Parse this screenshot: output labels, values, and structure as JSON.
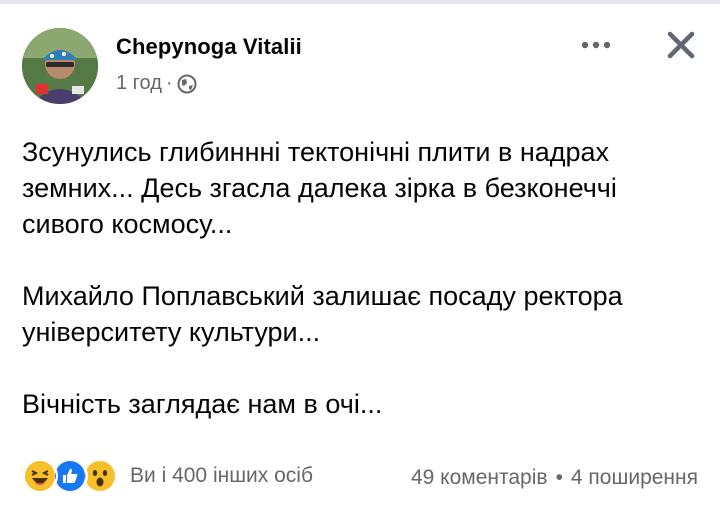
{
  "post": {
    "author": "Chepynoga Vitalii",
    "time": "1 год",
    "separator": "·",
    "privacy_icon": "globe-icon",
    "more_icon": "more-horizontal-icon",
    "close_icon": "close-icon",
    "paragraphs": [
      {
        "lines": [
          "Зсунулись глибиннні тектонічні плити в надрах",
          "земних... Десь згасла далека зірка в безконеччі",
          "сивого космосу..."
        ]
      },
      {
        "lines": [
          "Михайло Поплавський залишає посаду ректора",
          "університету культури..."
        ]
      },
      {
        "lines": [
          "Вічність заглядає нам в очі..."
        ]
      }
    ]
  },
  "footer": {
    "reaction_icons": [
      "haha-reaction-icon",
      "like-reaction-icon",
      "wow-reaction-icon"
    ],
    "reaction_text": "Ви і 400 інших осіб",
    "comments": "49 коментарів",
    "dot": "•",
    "shares": "4 поширення"
  },
  "colors": {
    "secondary_text": "#65676b",
    "like_blue": "#1877f2",
    "reaction_yellow": "#f7c02b"
  }
}
